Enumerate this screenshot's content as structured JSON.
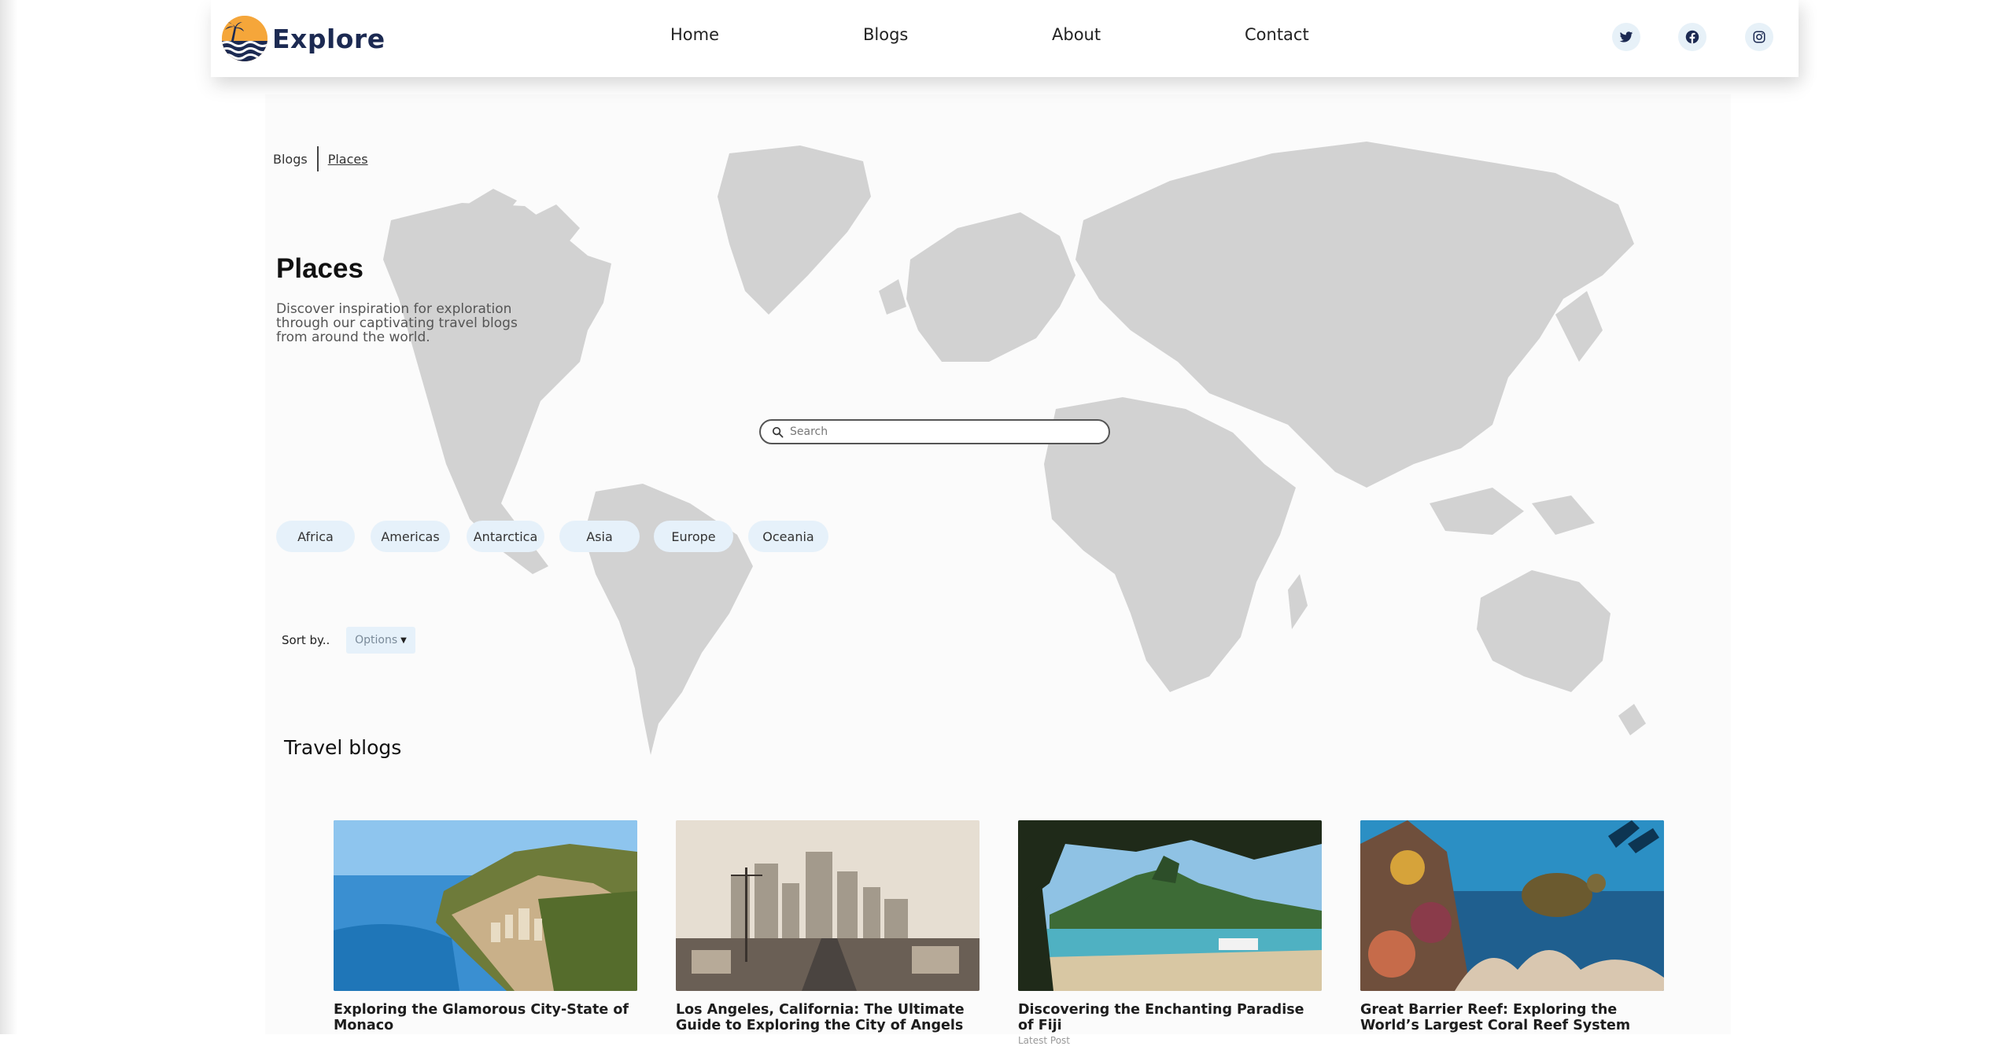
{
  "brand": {
    "name": "Explore"
  },
  "nav": {
    "items": [
      {
        "label": "Home"
      },
      {
        "label": "Blogs"
      },
      {
        "label": "About"
      },
      {
        "label": "Contact"
      }
    ]
  },
  "social": [
    {
      "icon": "twitter-icon"
    },
    {
      "icon": "facebook-icon"
    },
    {
      "icon": "instagram-icon"
    }
  ],
  "breadcrumb": {
    "parent": "Blogs",
    "current": "Places"
  },
  "hero": {
    "title": "Places",
    "description": "Discover inspiration for exploration through our captivating travel blogs from around the world."
  },
  "search": {
    "placeholder": "Search",
    "value": ""
  },
  "regions": [
    {
      "label": "Africa"
    },
    {
      "label": "Americas"
    },
    {
      "label": "Antarctica"
    },
    {
      "label": "Asia"
    },
    {
      "label": "Europe"
    },
    {
      "label": "Oceania"
    }
  ],
  "sort": {
    "label": "Sort by..",
    "selected": "Options"
  },
  "blogs": {
    "heading": "Travel blogs",
    "items": [
      {
        "title": "Exploring the Glamorous City-State of Monaco",
        "meta": ""
      },
      {
        "title": "Los Angeles, California: The Ultimate Guide to Exploring the City of Angels",
        "meta": ""
      },
      {
        "title": "Discovering the Enchanting Paradise of Fiji",
        "meta": "Latest Post"
      },
      {
        "title": "Great Barrier Reef: Exploring the World’s Largest Coral Reef System",
        "meta": ""
      }
    ]
  },
  "colors": {
    "brand_navy": "#1c2a52",
    "brand_orange": "#f08a24",
    "chip_bg": "#e6f1fa",
    "map_land": "#cfcfcf",
    "page_bg": "#fbfbfb"
  }
}
